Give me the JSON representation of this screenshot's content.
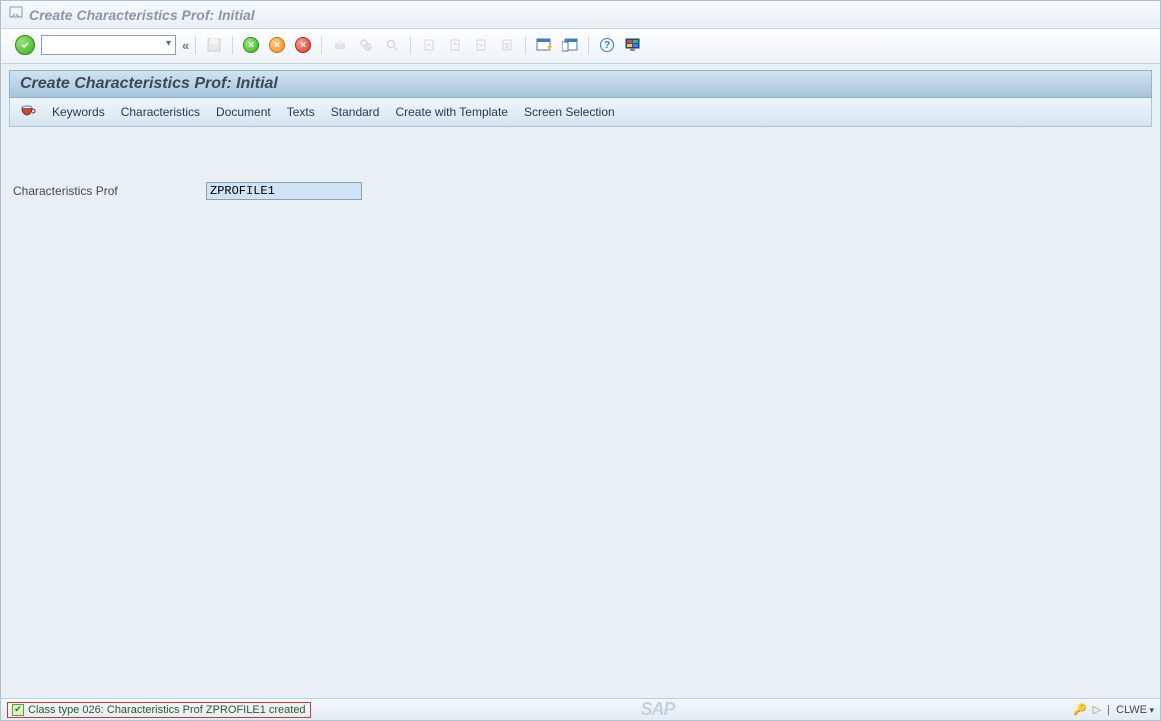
{
  "titlebar": {
    "title": "Create Characteristics Prof: Initial"
  },
  "system_toolbar": {
    "chevrons": "«"
  },
  "screen_title": "Create Characteristics Prof: Initial",
  "app_toolbar": {
    "btn1": "Keywords",
    "btn2": "Characteristics",
    "btn3": "Document",
    "btn4": "Texts",
    "btn5": "Standard",
    "btn6": "Create with Template",
    "btn7": "Screen Selection"
  },
  "form": {
    "char_prof_label": "Characteristics Prof",
    "char_prof_value": "ZPROFILE1"
  },
  "statusbar": {
    "message": "Class type 026: Characteristics Prof ZPROFILE1 created",
    "sap": "SAP",
    "system": "CLWE"
  }
}
